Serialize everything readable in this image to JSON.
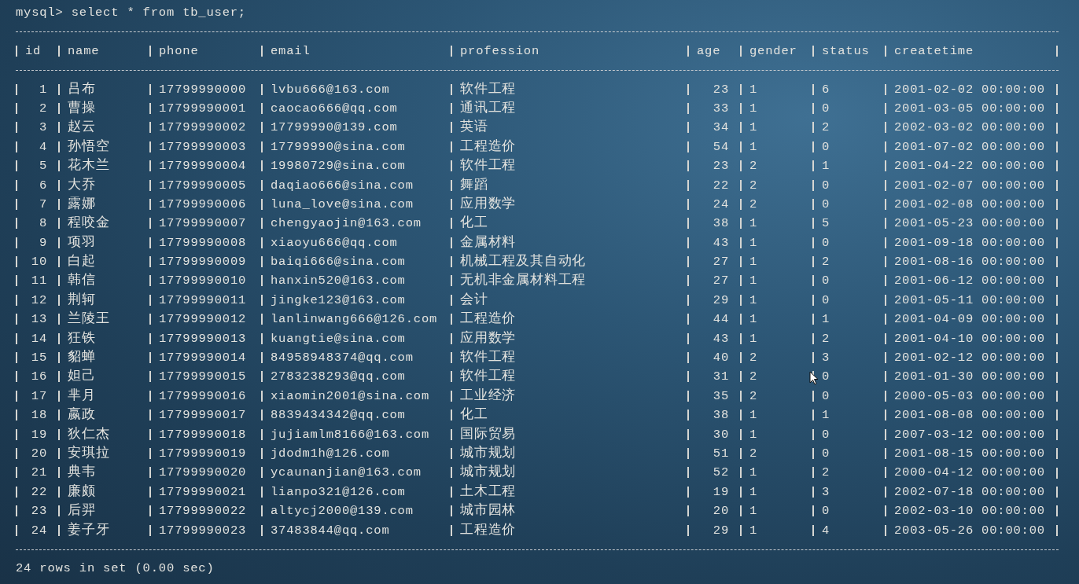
{
  "prompt": "mysql> select * from tb_user;",
  "columns": [
    "id",
    "name",
    "phone",
    "email",
    "profession",
    "age",
    "gender",
    "status",
    "createtime"
  ],
  "rows": [
    [
      "1",
      "吕布",
      "17799990000",
      "lvbu666@163.com",
      "软件工程",
      "23",
      "1",
      "6",
      "2001-02-02 00:00:00"
    ],
    [
      "2",
      "曹操",
      "17799990001",
      "caocao666@qq.com",
      "通讯工程",
      "33",
      "1",
      "0",
      "2001-03-05 00:00:00"
    ],
    [
      "3",
      "赵云",
      "17799990002",
      "17799990@139.com",
      "英语",
      "34",
      "1",
      "2",
      "2002-03-02 00:00:00"
    ],
    [
      "4",
      "孙悟空",
      "17799990003",
      "17799990@sina.com",
      "工程造价",
      "54",
      "1",
      "0",
      "2001-07-02 00:00:00"
    ],
    [
      "5",
      "花木兰",
      "17799990004",
      "19980729@sina.com",
      "软件工程",
      "23",
      "2",
      "1",
      "2001-04-22 00:00:00"
    ],
    [
      "6",
      "大乔",
      "17799990005",
      "daqiao666@sina.com",
      "舞蹈",
      "22",
      "2",
      "0",
      "2001-02-07 00:00:00"
    ],
    [
      "7",
      "露娜",
      "17799990006",
      "luna_love@sina.com",
      "应用数学",
      "24",
      "2",
      "0",
      "2001-02-08 00:00:00"
    ],
    [
      "8",
      "程咬金",
      "17799990007",
      "chengyaojin@163.com",
      "化工",
      "38",
      "1",
      "5",
      "2001-05-23 00:00:00"
    ],
    [
      "9",
      "项羽",
      "17799990008",
      "xiaoyu666@qq.com",
      "金属材料",
      "43",
      "1",
      "0",
      "2001-09-18 00:00:00"
    ],
    [
      "10",
      "白起",
      "17799990009",
      "baiqi666@sina.com",
      "机械工程及其自动化",
      "27",
      "1",
      "2",
      "2001-08-16 00:00:00"
    ],
    [
      "11",
      "韩信",
      "17799990010",
      "hanxin520@163.com",
      "无机非金属材料工程",
      "27",
      "1",
      "0",
      "2001-06-12 00:00:00"
    ],
    [
      "12",
      "荆轲",
      "17799990011",
      "jingke123@163.com",
      "会计",
      "29",
      "1",
      "0",
      "2001-05-11 00:00:00"
    ],
    [
      "13",
      "兰陵王",
      "17799990012",
      "lanlinwang666@126.com",
      "工程造价",
      "44",
      "1",
      "1",
      "2001-04-09 00:00:00"
    ],
    [
      "14",
      "狂铁",
      "17799990013",
      "kuangtie@sina.com",
      "应用数学",
      "43",
      "1",
      "2",
      "2001-04-10 00:00:00"
    ],
    [
      "15",
      "貂蝉",
      "17799990014",
      "84958948374@qq.com",
      "软件工程",
      "40",
      "2",
      "3",
      "2001-02-12 00:00:00"
    ],
    [
      "16",
      "妲己",
      "17799990015",
      "2783238293@qq.com",
      "软件工程",
      "31",
      "2",
      "0",
      "2001-01-30 00:00:00"
    ],
    [
      "17",
      "芈月",
      "17799990016",
      "xiaomin2001@sina.com",
      "工业经济",
      "35",
      "2",
      "0",
      "2000-05-03 00:00:00"
    ],
    [
      "18",
      "嬴政",
      "17799990017",
      "8839434342@qq.com",
      "化工",
      "38",
      "1",
      "1",
      "2001-08-08 00:00:00"
    ],
    [
      "19",
      "狄仁杰",
      "17799990018",
      "jujiamlm8166@163.com",
      "国际贸易",
      "30",
      "1",
      "0",
      "2007-03-12 00:00:00"
    ],
    [
      "20",
      "安琪拉",
      "17799990019",
      "jdodm1h@126.com",
      "城市规划",
      "51",
      "2",
      "0",
      "2001-08-15 00:00:00"
    ],
    [
      "21",
      "典韦",
      "17799990020",
      "ycaunanjian@163.com",
      "城市规划",
      "52",
      "1",
      "2",
      "2000-04-12 00:00:00"
    ],
    [
      "22",
      "廉颇",
      "17799990021",
      "lianpo321@126.com",
      "土木工程",
      "19",
      "1",
      "3",
      "2002-07-18 00:00:00"
    ],
    [
      "23",
      "后羿",
      "17799990022",
      "altycj2000@139.com",
      "城市园林",
      "20",
      "1",
      "0",
      "2002-03-10 00:00:00"
    ],
    [
      "24",
      "姜子牙",
      "17799990023",
      "37483844@qq.com",
      "工程造价",
      "29",
      "1",
      "4",
      "2003-05-26 00:00:00"
    ]
  ],
  "footer": "24 rows in set (0.00 sec)"
}
